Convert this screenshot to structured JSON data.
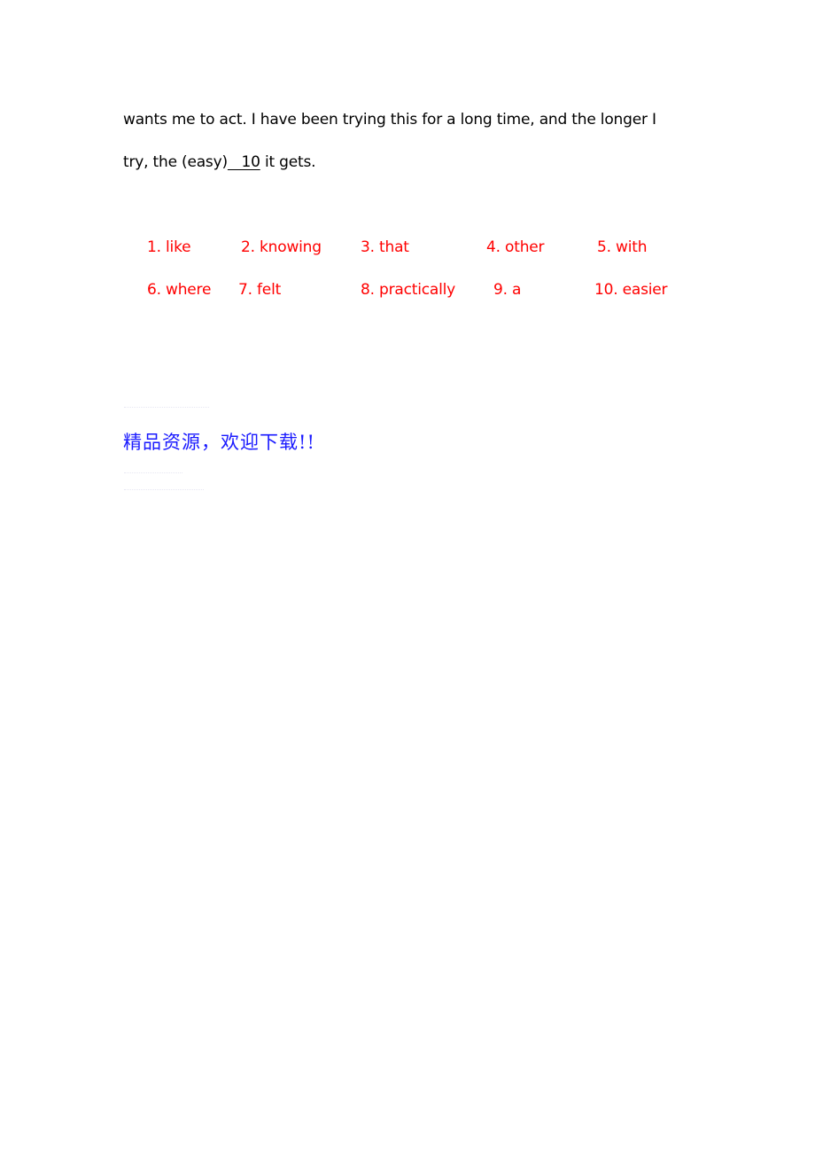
{
  "document": {
    "passage": {
      "line1": "wants me to act. I have been trying this for a long time, and the longer I",
      "line2_before": "try, the (easy)",
      "line2_blank": "   10",
      "line2_after": " it gets."
    },
    "answers": [
      {
        "label": "1. like"
      },
      {
        "label": "2. knowing"
      },
      {
        "label": "3. that"
      },
      {
        "label": "4. other"
      },
      {
        "label": "5. with"
      },
      {
        "label": "6. where"
      },
      {
        "label": "7. felt"
      },
      {
        "label": "8. practically"
      },
      {
        "label": "9. a"
      },
      {
        "label": "10. easier"
      }
    ],
    "answer_color": "#ff0000",
    "promo_text": "精品资源，欢迎下载!!",
    "promo_color": "#1a1aff"
  }
}
